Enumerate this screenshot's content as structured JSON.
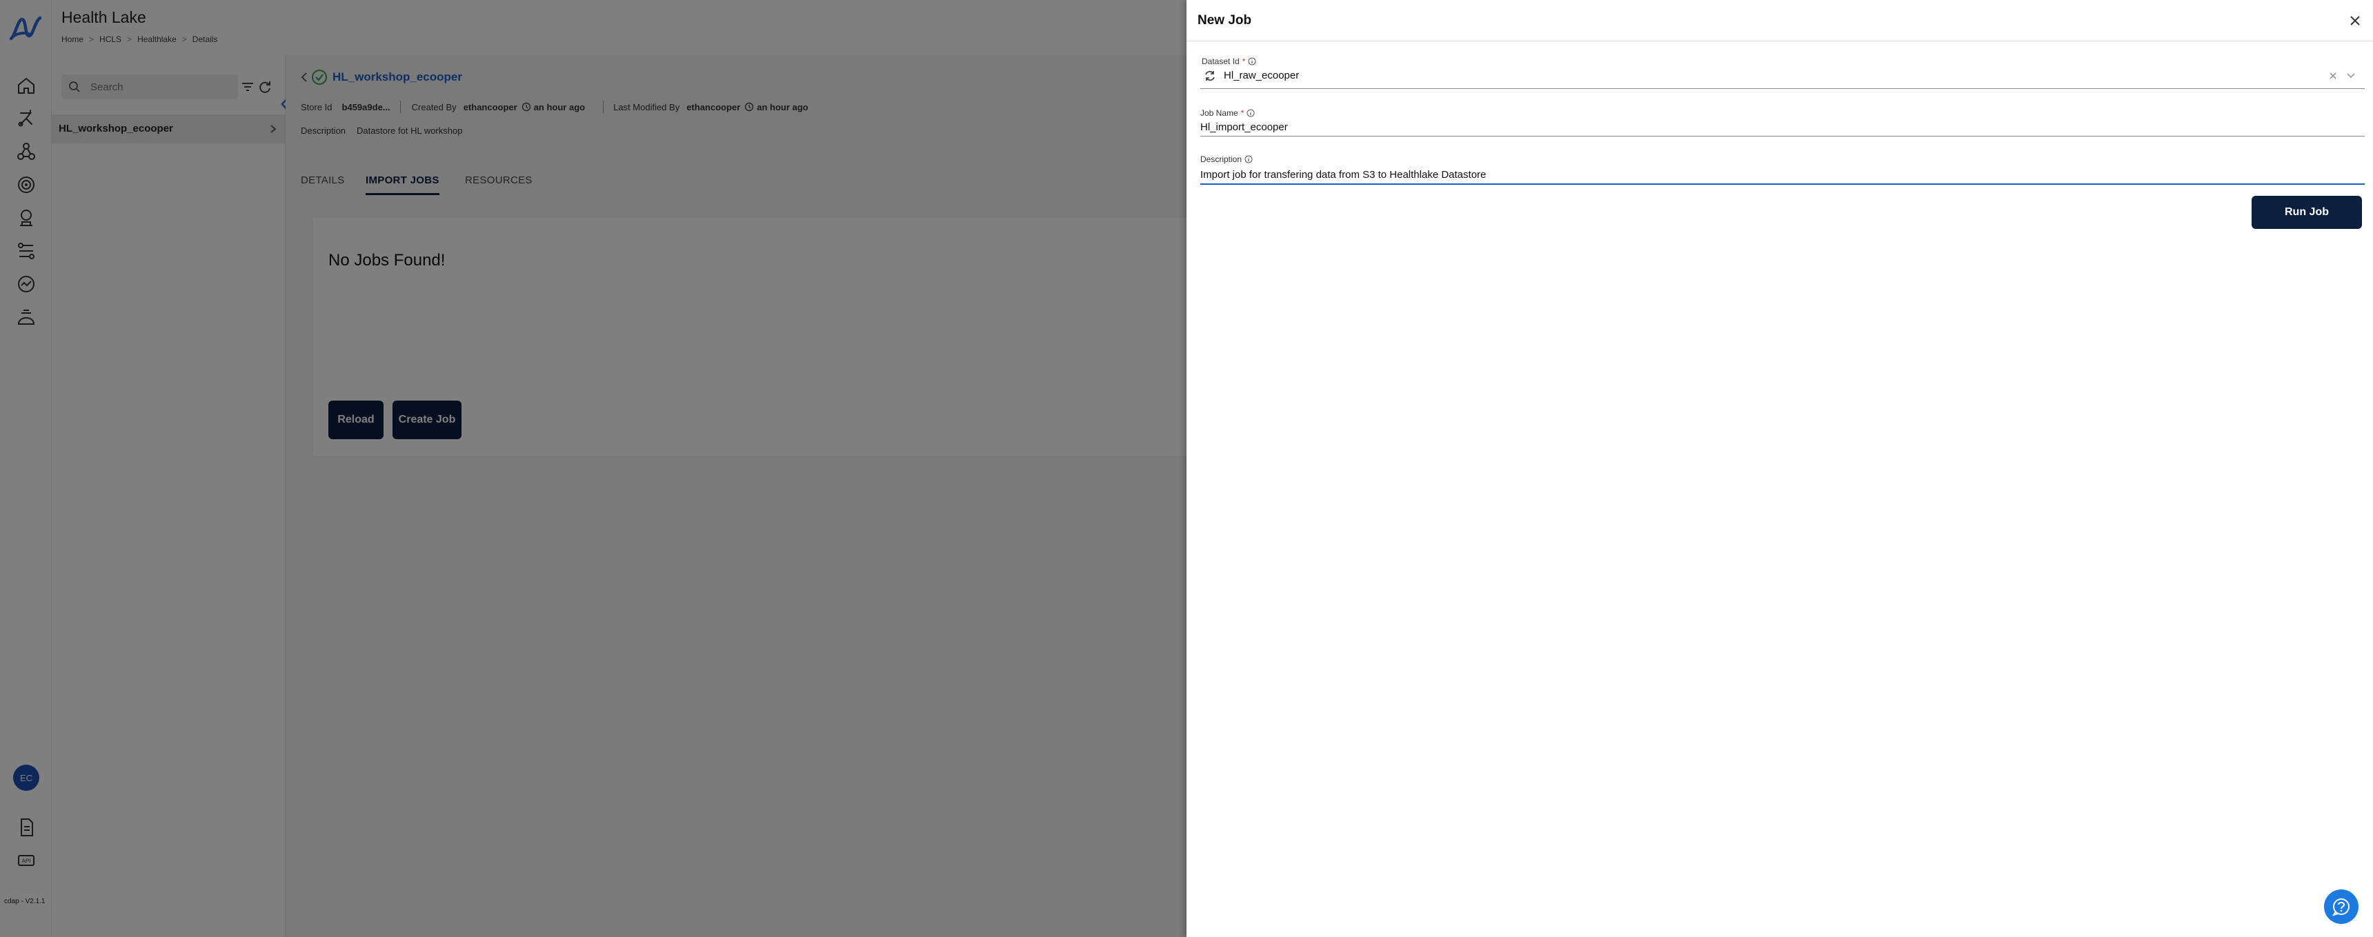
{
  "app": {
    "title": "Health Lake",
    "breadcrumb": [
      "Home",
      "HCLS",
      "Healthlake",
      "Details"
    ],
    "breadcrumb_sep": ">",
    "version": "cdap - V2.1.1",
    "user_initials": "EC",
    "accent_color": "#0b1f3f"
  },
  "rail": {
    "icons": [
      "home-icon",
      "pipeline-icon",
      "network-icon",
      "target-icon",
      "badge-icon",
      "workflow-icon",
      "gauge-icon",
      "dashboard-icon"
    ],
    "bottom_icons": [
      "document-icon",
      "api-icon"
    ]
  },
  "tree": {
    "search_placeholder": "Search",
    "items": [
      {
        "label": "HL_workshop_ecooper"
      }
    ]
  },
  "main": {
    "store_name": "HL_workshop_ecooper",
    "meta": {
      "store_id_label": "Store Id",
      "store_id_value": "b459a9de...",
      "created_by_label": "Created By",
      "created_by_value": "ethancooper",
      "created_time": "an hour ago",
      "modified_by_label": "Last Modified By",
      "modified_by_value": "ethancooper",
      "modified_time": "an hour ago",
      "description_label": "Description",
      "description_value": "Datastore fot HL workshop"
    },
    "tabs": [
      {
        "label": "DETAILS",
        "active": false
      },
      {
        "label": "IMPORT JOBS",
        "active": true
      },
      {
        "label": "RESOURCES",
        "active": false
      }
    ],
    "empty_message": "No Jobs Found!",
    "reload_label": "Reload",
    "create_job_label": "Create Job"
  },
  "drawer": {
    "title": "New Job",
    "dataset_label": "Dataset Id",
    "dataset_value": "Hl_raw_ecooper",
    "job_name_label": "Job Name",
    "job_name_value": "Hl_import_ecooper",
    "description_label": "Description",
    "description_value": "Import job for transfering data from S3 to Healthlake Datastore",
    "required_mark": "*",
    "run_label": "Run Job"
  }
}
